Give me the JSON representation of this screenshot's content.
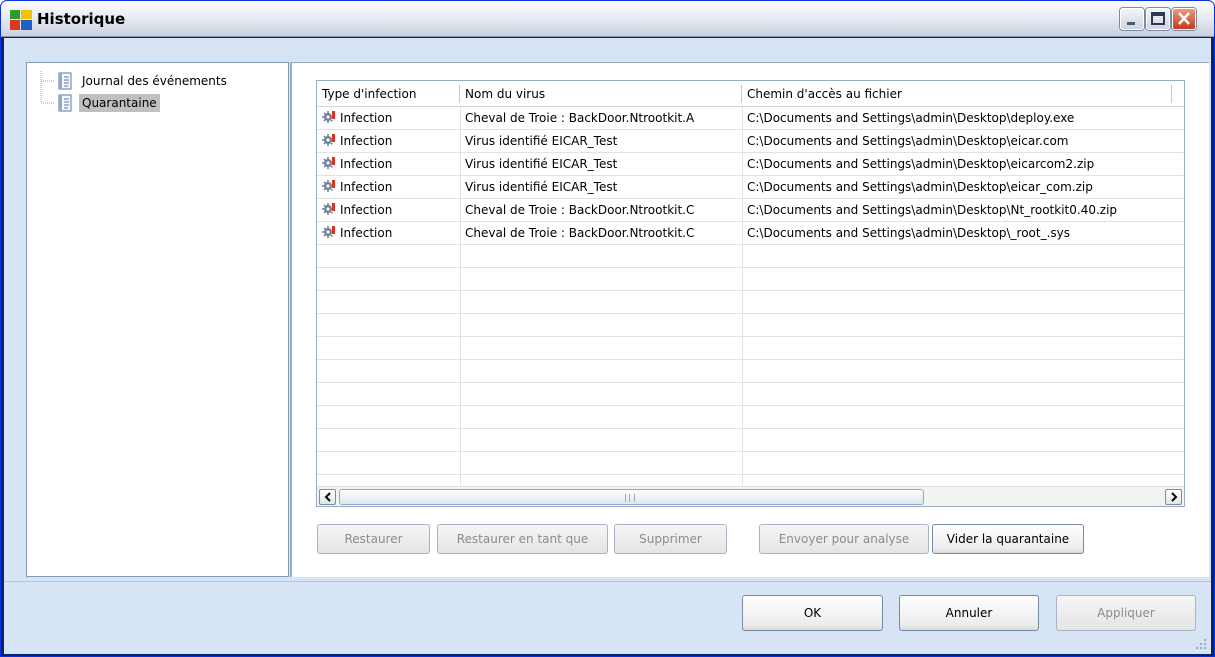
{
  "window": {
    "title": "Historique"
  },
  "tree": {
    "items": [
      {
        "label": "Journal des événements",
        "icon": "document-list-icon"
      },
      {
        "label": "Quarantaine",
        "icon": "document-list-icon",
        "selected": true
      }
    ]
  },
  "table": {
    "columns": [
      "Type d'infection",
      "Nom du virus",
      "Chemin d'accès au fichier"
    ],
    "rows": [
      {
        "type": "Infection",
        "name": "Cheval de Troie : BackDoor.Ntrootkit.A",
        "path": "C:\\Documents and Settings\\admin\\Desktop\\deploy.exe"
      },
      {
        "type": "Infection",
        "name": "Virus identifié EICAR_Test",
        "path": "C:\\Documents and Settings\\admin\\Desktop\\eicar.com"
      },
      {
        "type": "Infection",
        "name": "Virus identifié EICAR_Test",
        "path": "C:\\Documents and Settings\\admin\\Desktop\\eicarcom2.zip"
      },
      {
        "type": "Infection",
        "name": "Virus identifié EICAR_Test",
        "path": "C:\\Documents and Settings\\admin\\Desktop\\eicar_com.zip"
      },
      {
        "type": "Infection",
        "name": "Cheval de Troie : BackDoor.Ntrootkit.C",
        "path": "C:\\Documents and Settings\\admin\\Desktop\\Nt_rootkit0.40.zip"
      },
      {
        "type": "Infection",
        "name": "Cheval de Troie : BackDoor.Ntrootkit.C",
        "path": "C:\\Documents and Settings\\admin\\Desktop\\_root_.sys"
      }
    ]
  },
  "actions": {
    "restore": "Restaurer",
    "restore_as": "Restaurer en tant que",
    "delete": "Supprimer",
    "send_analysis": "Envoyer pour analyse",
    "empty_quarantine": "Vider la quarantaine"
  },
  "dialog": {
    "ok": "OK",
    "cancel": "Annuler",
    "apply": "Appliquer"
  },
  "colors": {
    "accent": "#0a246a",
    "client_bg": "#d6e4f5",
    "close_button": "#c8391c"
  }
}
